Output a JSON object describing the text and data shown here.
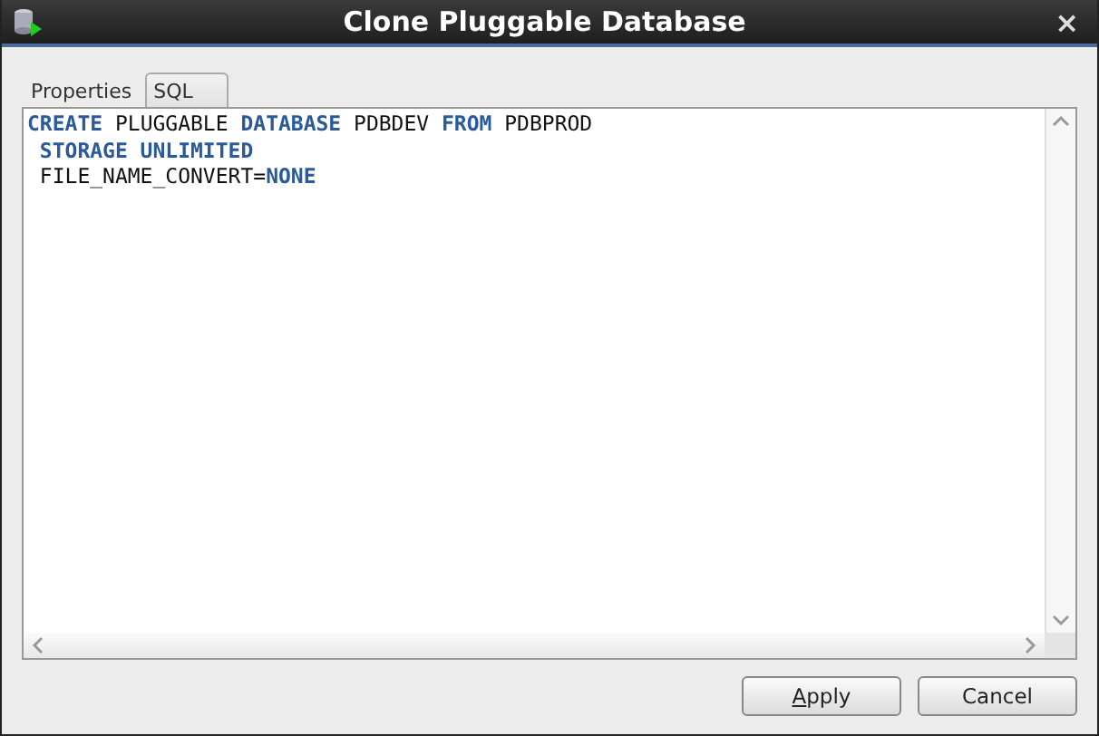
{
  "window": {
    "title": "Clone Pluggable Database",
    "close": "×"
  },
  "tabs": [
    {
      "label": "Properties",
      "selected": false
    },
    {
      "label": "SQL",
      "selected": true
    }
  ],
  "sql_lines": [
    [
      {
        "kind": "keyword",
        "text": "CREATE"
      },
      {
        "kind": "plain",
        "text": " PLUGGABLE "
      },
      {
        "kind": "keyword",
        "text": "DATABASE"
      },
      {
        "kind": "plain",
        "text": " PDBDEV "
      },
      {
        "kind": "keyword",
        "text": "FROM"
      },
      {
        "kind": "plain",
        "text": " PDBPROD"
      }
    ],
    [
      {
        "kind": "keyword",
        "text": " STORAGE UNLIMITED"
      }
    ],
    [
      {
        "kind": "plain",
        "text": " FILE_NAME_CONVERT="
      },
      {
        "kind": "keyword",
        "text": "NONE"
      }
    ]
  ],
  "buttons": [
    {
      "label": "Apply",
      "mnemonic": true
    },
    {
      "label": "Cancel",
      "mnemonic": false
    }
  ]
}
